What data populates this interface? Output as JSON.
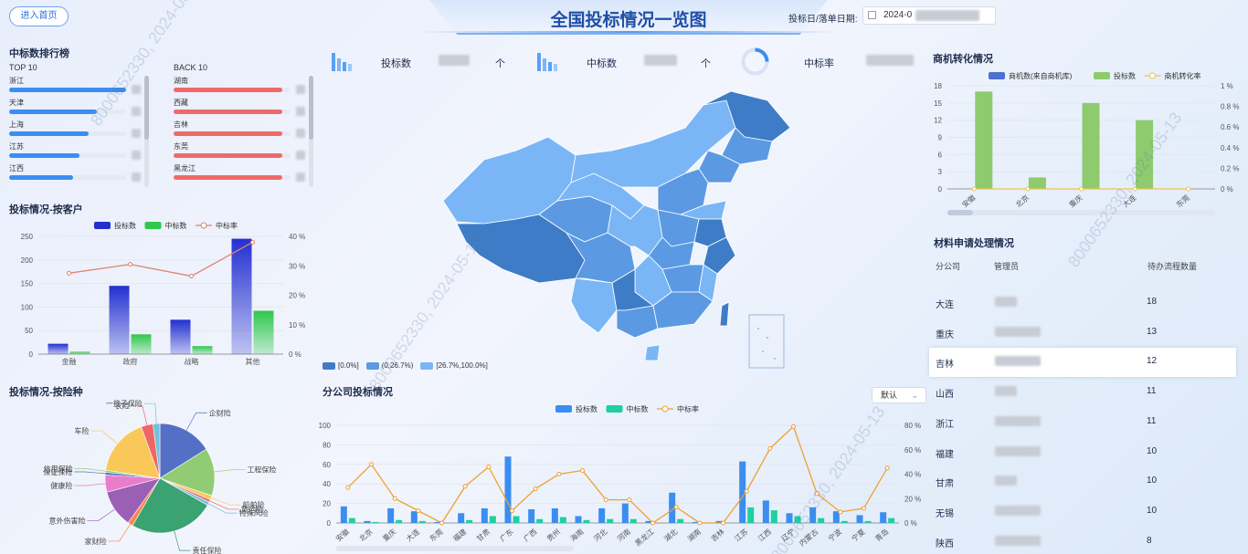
{
  "header": {
    "home_button": "进入首页",
    "title": "全国投标情况一览图",
    "date_label": "投标日/落单日期:",
    "date_value": "2024-0"
  },
  "ranking": {
    "title": "中标数排行榜",
    "top_label": "TOP 10",
    "back_label": "BACK 10",
    "top": [
      {
        "name": "浙江",
        "level": 1.0
      },
      {
        "name": "天津",
        "level": 0.75
      },
      {
        "name": "上海",
        "level": 0.68
      },
      {
        "name": "江苏",
        "level": 0.6
      },
      {
        "name": "江西",
        "level": 0.55
      }
    ],
    "back": [
      {
        "name": "湖南",
        "level": 0.93
      },
      {
        "name": "西藏",
        "level": 0.93
      },
      {
        "name": "吉林",
        "level": 0.93
      },
      {
        "name": "东莞",
        "level": 0.93
      },
      {
        "name": "黑龙江",
        "level": 0.93
      }
    ],
    "top_color": "#3b8ef0",
    "back_color": "#ee6a6a"
  },
  "stats": [
    {
      "label": "投标数",
      "unit": "个"
    },
    {
      "label": "中标数",
      "unit": "个"
    },
    {
      "label": "中标率",
      "unit": ""
    }
  ],
  "map_legend": [
    "[0.0%]",
    "(0,26.7%)",
    "[26.7%,100.0%]"
  ],
  "map_colors": [
    "#3f7cc7",
    "#5b9ae3",
    "#7ab6f6"
  ],
  "customer": {
    "title": "投标情况-按客户",
    "chart_data": {
      "type": "bar",
      "categories": [
        "金融",
        "政府",
        "战略",
        "其他"
      ],
      "series": [
        {
          "name": "投标数",
          "values": [
            22,
            145,
            73,
            245
          ]
        },
        {
          "name": "中标数",
          "values": [
            5,
            42,
            17,
            92
          ]
        },
        {
          "name": "中标率",
          "values": [
            27.5,
            30.5,
            26.5,
            38
          ]
        }
      ],
      "ylim": [
        0,
        250
      ],
      "y2lim": [
        0,
        40
      ],
      "yticks": [
        "0",
        "50",
        "100",
        "150",
        "200",
        "250"
      ],
      "y2ticks": [
        "0 %",
        "10 %",
        "20 %",
        "30 %",
        "40 %"
      ]
    }
  },
  "insurance": {
    "title": "投标情况-按险种",
    "chart_data": {
      "type": "pie",
      "labels": [
        "企财险",
        "工程保险",
        "船舶险",
        "货运险",
        "特殊风险",
        "责任保险",
        "家财险",
        "意外伤害险",
        "健康险",
        "保证保险",
        "信用保险",
        "车险",
        "农险",
        "一揽子保险"
      ],
      "values": [
        16,
        14,
        1.2,
        0.8,
        1,
        25,
        1.5,
        11,
        5,
        0.8,
        0.6,
        17,
        3.5,
        2
      ],
      "colors": [
        "#5470c6",
        "#91cc75",
        "#fac858",
        "#ee6666",
        "#73c0de",
        "#3ba272",
        "#fc8452",
        "#9a60b4",
        "#ea7ccc",
        "#5470c6",
        "#91cc75",
        "#fac858",
        "#ee6666",
        "#73c0de"
      ]
    }
  },
  "branch": {
    "title": "分公司投标情况",
    "dropdown": "默认",
    "chart_data": {
      "type": "bar",
      "categories": [
        "安徽",
        "北京",
        "重庆",
        "大连",
        "东莞",
        "福建",
        "甘肃",
        "广东",
        "广西",
        "贵州",
        "海南",
        "河北",
        "河南",
        "黑龙江",
        "湖北",
        "湖南",
        "吉林",
        "江苏",
        "江西",
        "辽宁",
        "内蒙古",
        "宁波",
        "宁夏",
        "青岛"
      ],
      "series": [
        {
          "name": "投标数",
          "values": [
            17,
            2,
            15,
            12,
            1,
            10,
            15,
            68,
            14,
            15,
            7,
            15,
            20,
            2,
            31,
            1,
            2,
            63,
            23,
            10,
            16,
            12,
            8,
            11
          ]
        },
        {
          "name": "中标数",
          "values": [
            5,
            1,
            3,
            2,
            0,
            3,
            7,
            7,
            4,
            6,
            3,
            4,
            4,
            0,
            4,
            0,
            0,
            16,
            13,
            7,
            5,
            2,
            2,
            5
          ]
        },
        {
          "name": "中标率",
          "values": [
            29,
            48,
            20,
            10,
            0,
            30,
            46,
            10,
            28,
            40,
            43,
            19,
            19,
            0,
            13,
            0,
            0,
            26,
            61,
            79,
            24,
            9,
            12,
            45
          ]
        }
      ],
      "ylim": [
        0,
        100
      ],
      "y2lim": [
        0,
        80
      ],
      "yticks": [
        "0",
        "20",
        "40",
        "60",
        "80",
        "100"
      ],
      "y2ticks": [
        "0 %",
        "20 %",
        "40 %",
        "60 %",
        "80 %"
      ]
    }
  },
  "opportunity": {
    "title": "商机转化情况",
    "chart_data": {
      "type": "bar",
      "categories": [
        "安徽",
        "北京",
        "重庆",
        "大连",
        "东莞"
      ],
      "series": [
        {
          "name": "商机数(来自商机库)",
          "values": [
            0,
            0,
            0,
            0,
            0
          ]
        },
        {
          "name": "投标数",
          "values": [
            17,
            2,
            15,
            12,
            0
          ]
        },
        {
          "name": "商机转化率",
          "values": [
            0,
            0,
            0,
            0,
            0
          ]
        }
      ],
      "ylim": [
        0,
        18
      ],
      "y2lim": [
        0,
        1
      ],
      "yticks": [
        "0",
        "3",
        "6",
        "9",
        "12",
        "15",
        "18"
      ],
      "y2ticks": [
        "0 %",
        "0.2 %",
        "0.4 %",
        "0.6 %",
        "0.8 %",
        "1 %"
      ]
    }
  },
  "materials": {
    "title": "材料申请处理情况",
    "headers": [
      "分公司",
      "管理员",
      "待办流程数量"
    ],
    "rows": [
      {
        "branch": "大连",
        "count": "18"
      },
      {
        "branch": "重庆",
        "count": "13"
      },
      {
        "branch": "吉林",
        "count": "12"
      },
      {
        "branch": "山西",
        "count": "11"
      },
      {
        "branch": "浙江",
        "count": "11"
      },
      {
        "branch": "福建",
        "count": "10"
      },
      {
        "branch": "甘肃",
        "count": "10"
      },
      {
        "branch": "无锡",
        "count": "10"
      },
      {
        "branch": "陕西",
        "count": "8"
      }
    ]
  },
  "watermark": "8000652330, 2024-05-13"
}
